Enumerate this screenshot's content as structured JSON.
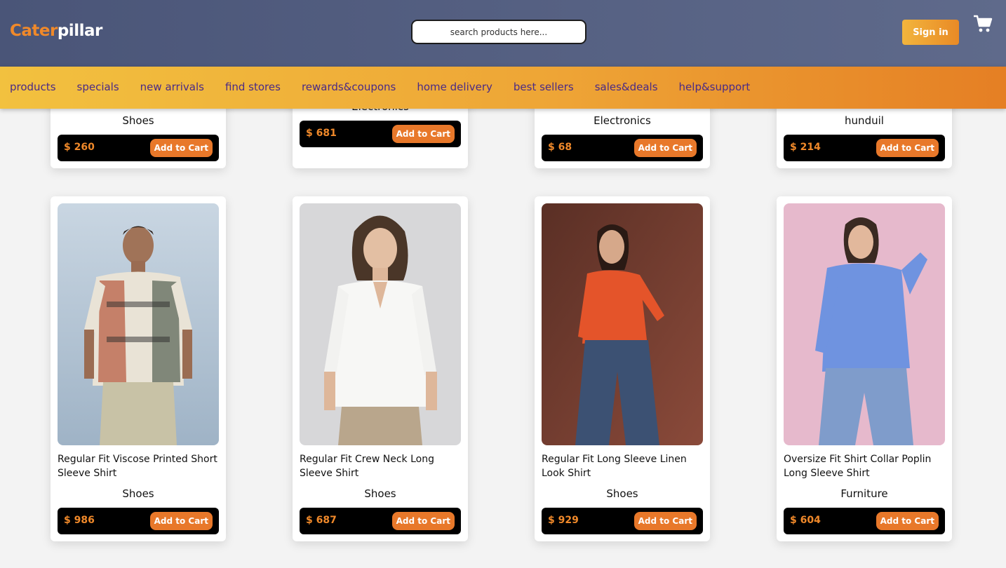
{
  "header": {
    "logo_part1": "Cater",
    "logo_part2": "pillar",
    "search_placeholder": "search products here...",
    "signin_label": "Sign in",
    "cart_icon": "cart-icon"
  },
  "nav": {
    "items": [
      "products",
      "specials",
      "new arrivals",
      "find stores",
      "rewards&coupons",
      "home delivery",
      "best sellers",
      "sales&deals",
      "help&support"
    ]
  },
  "colors": {
    "topbar": "#4a5578",
    "nav_gradient_start": "#f2c13f",
    "nav_gradient_end": "#e57f24",
    "nav_text": "#4a2a86",
    "accent": "#e8782a"
  },
  "top_row": [
    {
      "category": "Shoes",
      "price": "$ 260",
      "button": "Add to Cart"
    },
    {
      "category": "Electronics",
      "price": "$ 681",
      "button": "Add to Cart"
    },
    {
      "category": "Electronics",
      "price": "$ 68",
      "button": "Add to Cart"
    },
    {
      "category": "hunduil",
      "price": "$ 214",
      "button": "Add to Cart"
    }
  ],
  "products": [
    {
      "name": "Regular Fit Viscose Printed Short Sleeve Shirt",
      "category": "Shoes",
      "price": "$ 986",
      "button": "Add to Cart"
    },
    {
      "name": "Regular Fit Crew Neck Long Sleeve Shirt",
      "category": "Shoes",
      "price": "$ 687",
      "button": "Add to Cart"
    },
    {
      "name": "Regular Fit Long Sleeve Linen Look Shirt",
      "category": "Shoes",
      "price": "$ 929",
      "button": "Add to Cart"
    },
    {
      "name": "Oversize Fit Shirt Collar Poplin Long Sleeve Shirt",
      "category": "Furniture",
      "price": "$ 604",
      "button": "Add to Cart"
    }
  ]
}
